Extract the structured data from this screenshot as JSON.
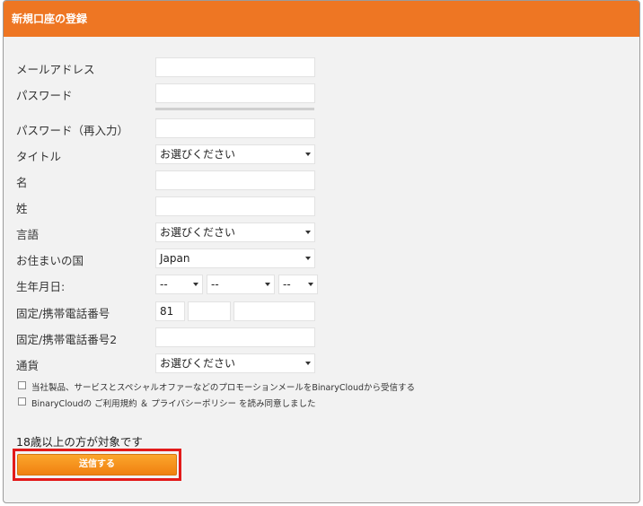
{
  "header": {
    "title": "新規口座の登録"
  },
  "form": {
    "email_label": "メールアドレス",
    "email_value": "",
    "password_label": "パスワード",
    "password_value": "",
    "password_confirm_label": "パスワード（再入力）",
    "password_confirm_value": "",
    "title_label": "タイトル",
    "title_selected": "お選びください",
    "first_name_label": "名",
    "first_name_value": "",
    "last_name_label": "姓",
    "last_name_value": "",
    "language_label": "言語",
    "language_selected": "お選びください",
    "country_label": "お住まいの国",
    "country_selected": "Japan",
    "birthdate_label": "生年月日:",
    "birth_year_selected": "--",
    "birth_month_selected": "--",
    "birth_day_selected": "--",
    "phone_label": "固定/携帯電話番号",
    "phone_country_code": "81",
    "phone_area_value": "",
    "phone_number_value": "",
    "phone2_label": "固定/携帯電話番号2",
    "phone2_value": "",
    "currency_label": "通貨",
    "currency_selected": "お選びください",
    "promo_checkbox_label": "当社製品、サービスとスペシャルオファーなどのプロモーションメールをBinaryCloudから受信する",
    "promo_checked": false,
    "terms_checkbox_label": "BinaryCloudの ご利用規約 ＆ プライバシーポリシー を読み同意しました",
    "terms_checked": false,
    "age_note": "18歳以上の方が対象です",
    "submit_label": "送信する"
  },
  "colors": {
    "header": "#ee7623",
    "submit": "#f5901e",
    "highlight": "#e21a1a",
    "panel": "#f2f2f2"
  }
}
